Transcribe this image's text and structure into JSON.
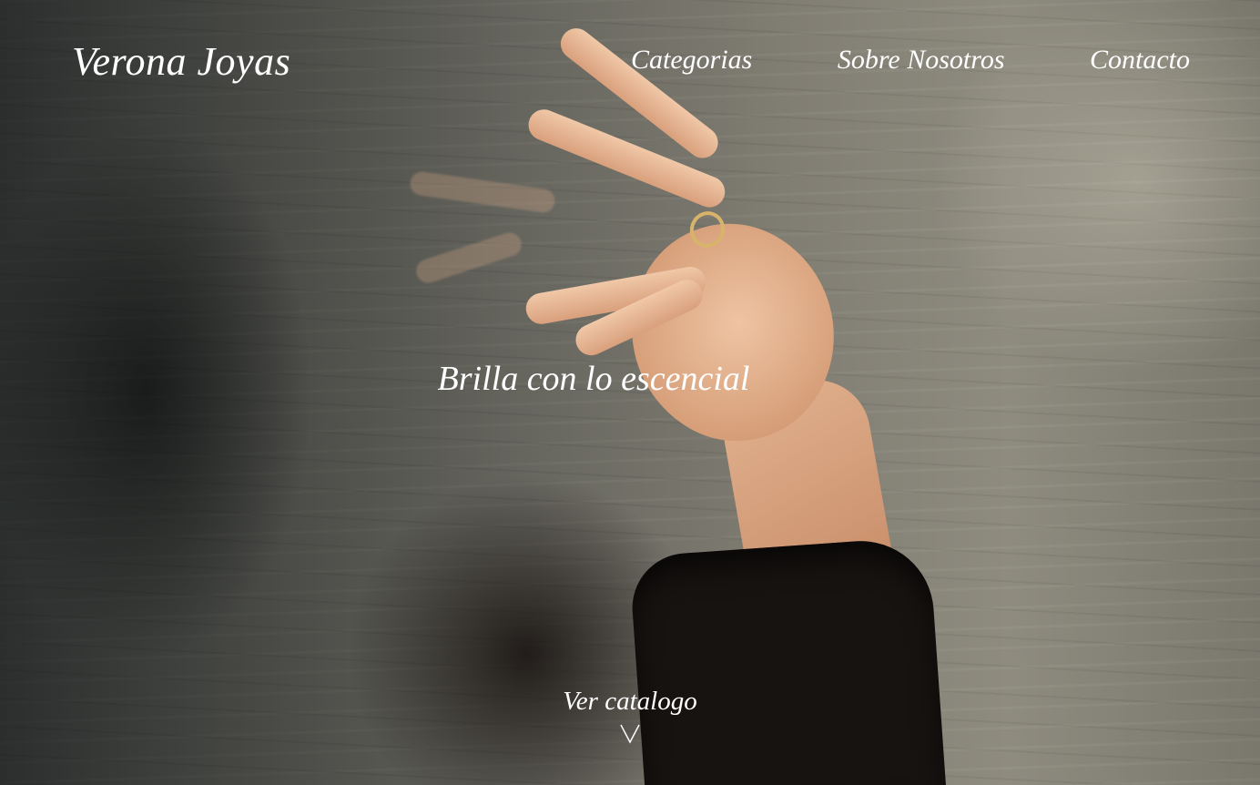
{
  "brand": {
    "name": "Verona Joyas"
  },
  "nav": {
    "items": [
      {
        "label": "Categorias"
      },
      {
        "label": "Sobre Nosotros"
      },
      {
        "label": "Contacto"
      }
    ]
  },
  "hero": {
    "tagline": "Brilla con lo escencial",
    "cta_label": "Ver catalogo",
    "cta_icon": "chevron-down-icon",
    "text_color": "#ffffff"
  }
}
